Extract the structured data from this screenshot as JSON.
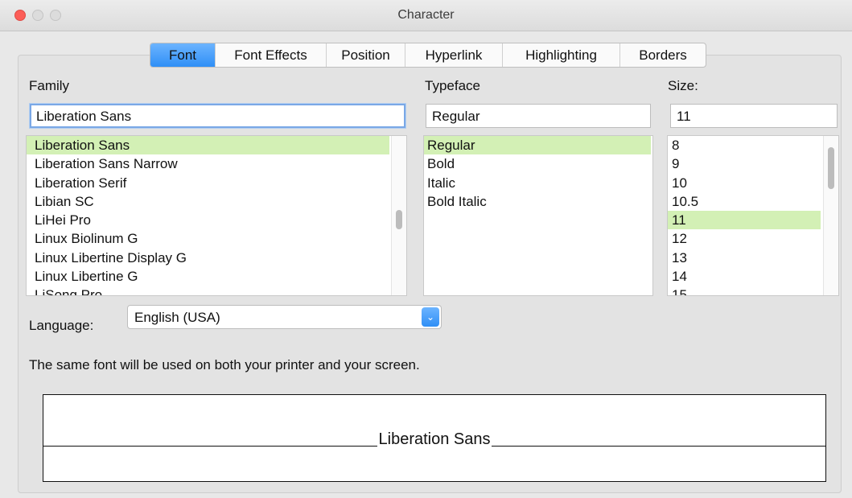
{
  "window": {
    "title": "Character"
  },
  "tabs": [
    {
      "label": "Font",
      "active": true
    },
    {
      "label": "Font Effects",
      "active": false
    },
    {
      "label": "Position",
      "active": false
    },
    {
      "label": "Hyperlink",
      "active": false
    },
    {
      "label": "Highlighting",
      "active": false
    },
    {
      "label": "Borders",
      "active": false
    }
  ],
  "family": {
    "label": "Family",
    "value": "Liberation Sans",
    "items": [
      "Liberation Sans",
      "Liberation Sans Narrow",
      "Liberation Serif",
      "Libian SC",
      "LiHei Pro",
      "Linux Biolinum G",
      "Linux Libertine Display G",
      "Linux Libertine G",
      "LiSong Pro"
    ],
    "selected": "Liberation Sans"
  },
  "typeface": {
    "label": "Typeface",
    "value": "Regular",
    "items": [
      "Regular",
      "Bold",
      "Italic",
      "Bold Italic"
    ],
    "selected": "Regular"
  },
  "size": {
    "label": "Size:",
    "value": "11",
    "items": [
      "8",
      "9",
      "10",
      "10.5",
      "11",
      "12",
      "13",
      "14",
      "15"
    ],
    "selected": "11"
  },
  "language": {
    "label": "Language:",
    "value": "English (USA)"
  },
  "info_text": "The same font will be used on both your printer and your screen.",
  "preview": {
    "text": "Liberation Sans"
  },
  "colors": {
    "selection": "#d3f0b5",
    "accent": "#2f8ff6",
    "close": "#fc5d57"
  },
  "icons": {
    "dropdown": "chevron-down-icon"
  }
}
